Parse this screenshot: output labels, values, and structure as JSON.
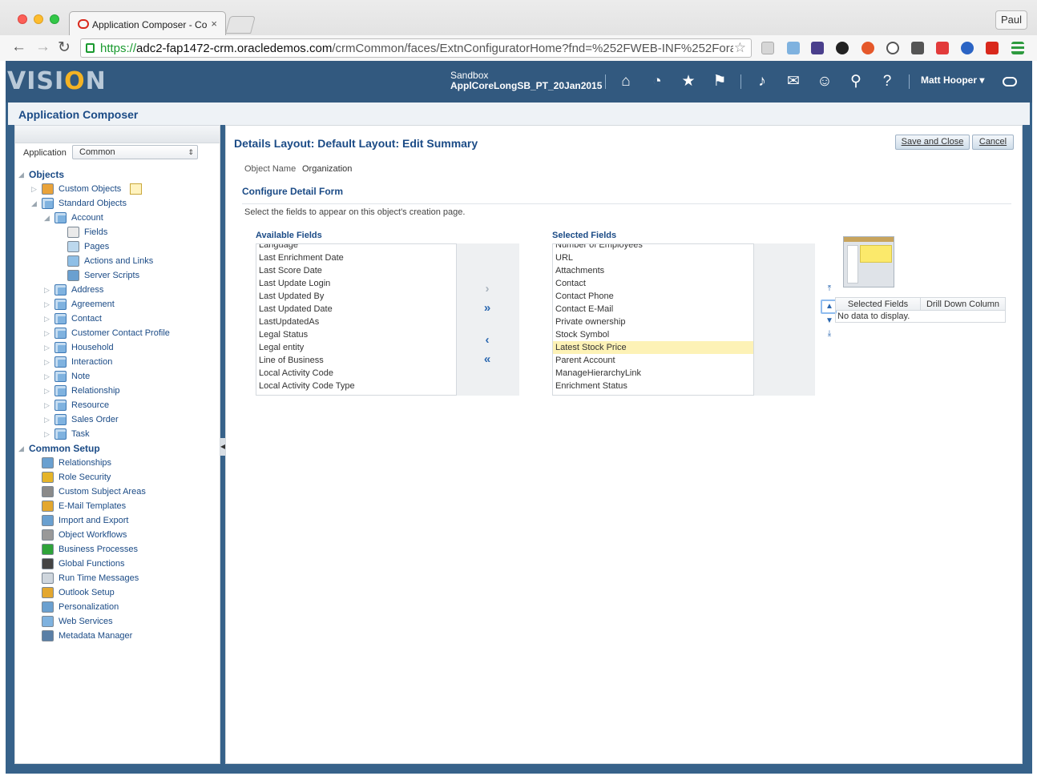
{
  "browser": {
    "tab_title": "Application Composer - Co",
    "tab_close": "×",
    "profile": "Paul",
    "url_scheme": "https://",
    "url_host": "adc2-fap1472-crm.oracledemos.com",
    "url_path": "/crmCommon/faces/ExtnConfiguratorHome?fnd=%252FWEB-INF%252Fora..."
  },
  "header": {
    "logo_pre": "VISI",
    "logo_o": "O",
    "logo_post": "N",
    "sandbox_label": "Sandbox",
    "sandbox_name": "ApplCoreLongSB_PT_20Jan2015",
    "user": "Matt Hooper ▾"
  },
  "app_title": "Application Composer",
  "left": {
    "app_label": "Application",
    "app_value": "Common",
    "objects_heading": "Objects",
    "custom_objects": "Custom Objects",
    "standard_objects": "Standard Objects",
    "account": "Account",
    "account_children": [
      "Fields",
      "Pages",
      "Actions and Links",
      "Server Scripts"
    ],
    "objects": [
      "Address",
      "Agreement",
      "Contact",
      "Customer Contact Profile",
      "Household",
      "Interaction",
      "Note",
      "Relationship",
      "Resource",
      "Sales Order",
      "Task"
    ],
    "common_setup_heading": "Common Setup",
    "common_setup": [
      "Relationships",
      "Role Security",
      "Custom Subject Areas",
      "E-Mail Templates",
      "Import and Export",
      "Object Workflows",
      "Business Processes",
      "Global Functions",
      "Run Time Messages",
      "Outlook Setup",
      "Personalization",
      "Web Services",
      "Metadata Manager"
    ]
  },
  "main": {
    "title": "Details Layout: Default Layout: Edit Summary",
    "save_close": "Save and Close",
    "cancel": "Cancel",
    "object_name_label": "Object Name",
    "object_name_value": "Organization",
    "section_title": "Configure Detail Form",
    "instructions": "Select the fields to appear on this object's creation page.",
    "available_label": "Available Fields",
    "available_fields": [
      "Language",
      "Last Enrichment Date",
      "Last Score Date",
      "Last Update Login",
      "Last Updated By",
      "Last Updated Date",
      "LastUpdatedAs",
      "Legal Status",
      "Legal entity",
      "Line of Business",
      "Local Activity Code",
      "Local Activity Code Type"
    ],
    "selected_label": "Selected Fields",
    "selected_fields": [
      "Number of Employees",
      "URL",
      "Attachments",
      "Contact",
      "Contact Phone",
      "Contact E-Mail",
      "Private ownership",
      "Stock Symbol",
      "Latest Stock Price",
      "Parent Account",
      "ManageHierarchyLink",
      "Enrichment Status"
    ],
    "selected_highlight": "Latest Stock Price",
    "drill_col1": "Selected Fields",
    "drill_col2": "Drill Down Column",
    "drill_empty": "No data to display."
  }
}
